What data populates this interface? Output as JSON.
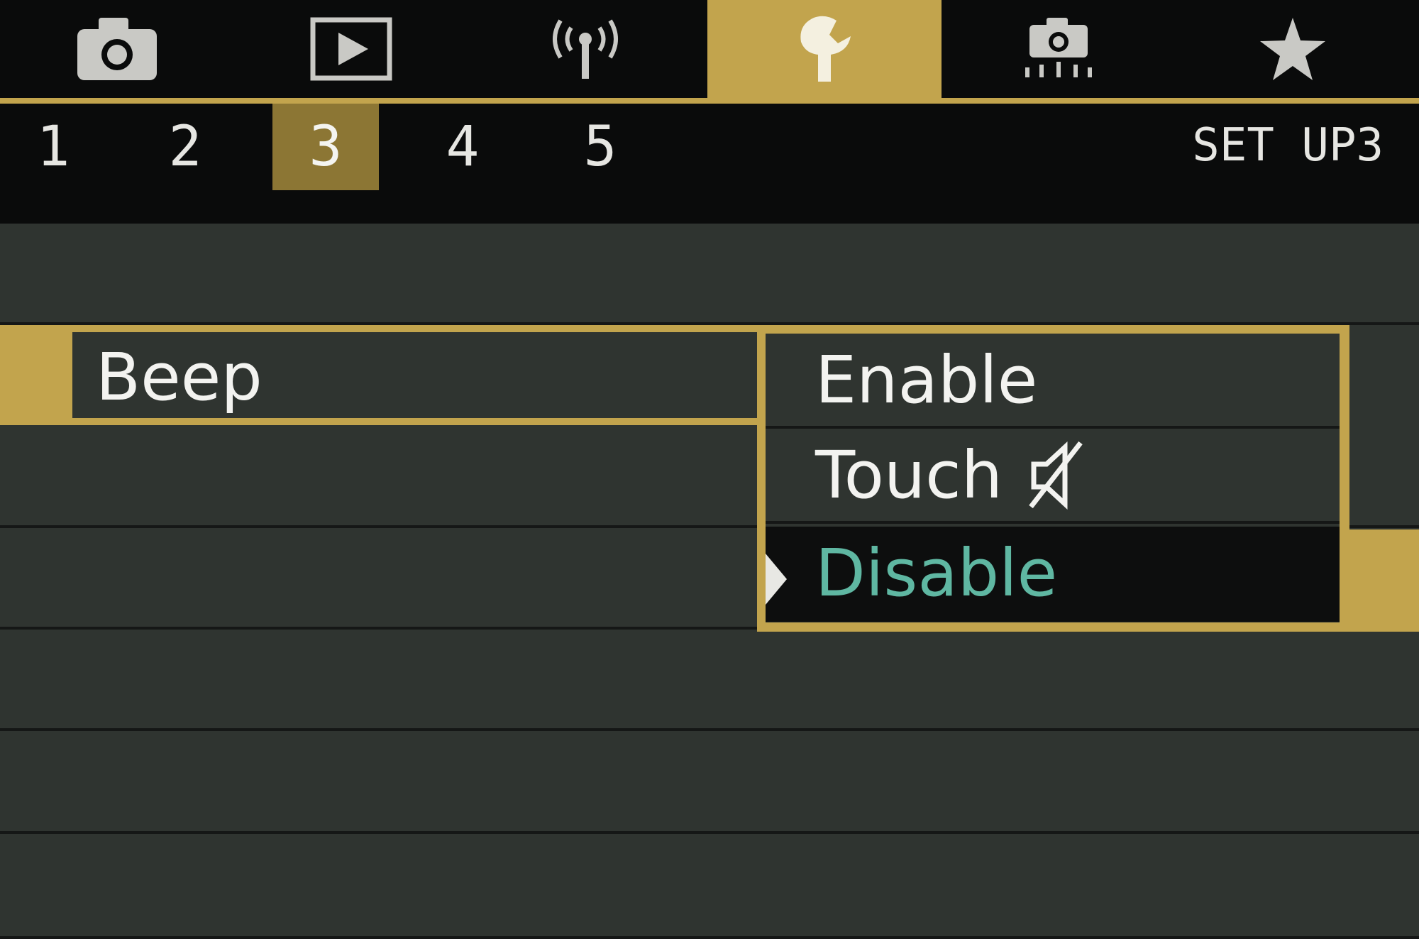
{
  "tabs": [
    {
      "icon": "camera-icon",
      "active": false
    },
    {
      "icon": "playback-icon",
      "active": false
    },
    {
      "icon": "wireless-icon",
      "active": false
    },
    {
      "icon": "wrench-icon",
      "active": true
    },
    {
      "icon": "custom-camera-icon",
      "active": false
    },
    {
      "icon": "star-icon",
      "active": false
    }
  ],
  "subtabs": [
    "1",
    "2",
    "3",
    "4",
    "5"
  ],
  "active_subtab": "3",
  "page_label": "SET UP3",
  "setting": {
    "label": "Beep"
  },
  "options": [
    {
      "label": "Enable",
      "selected": false
    },
    {
      "label": "Touch",
      "icon": "speaker-muted-icon",
      "selected": false
    },
    {
      "label": "Disable",
      "selected": true
    }
  ],
  "colors": {
    "accent": "#c2a44d",
    "selected_text": "#5fb7a2",
    "background": "#2f3430",
    "header": "#0a0b0b"
  }
}
